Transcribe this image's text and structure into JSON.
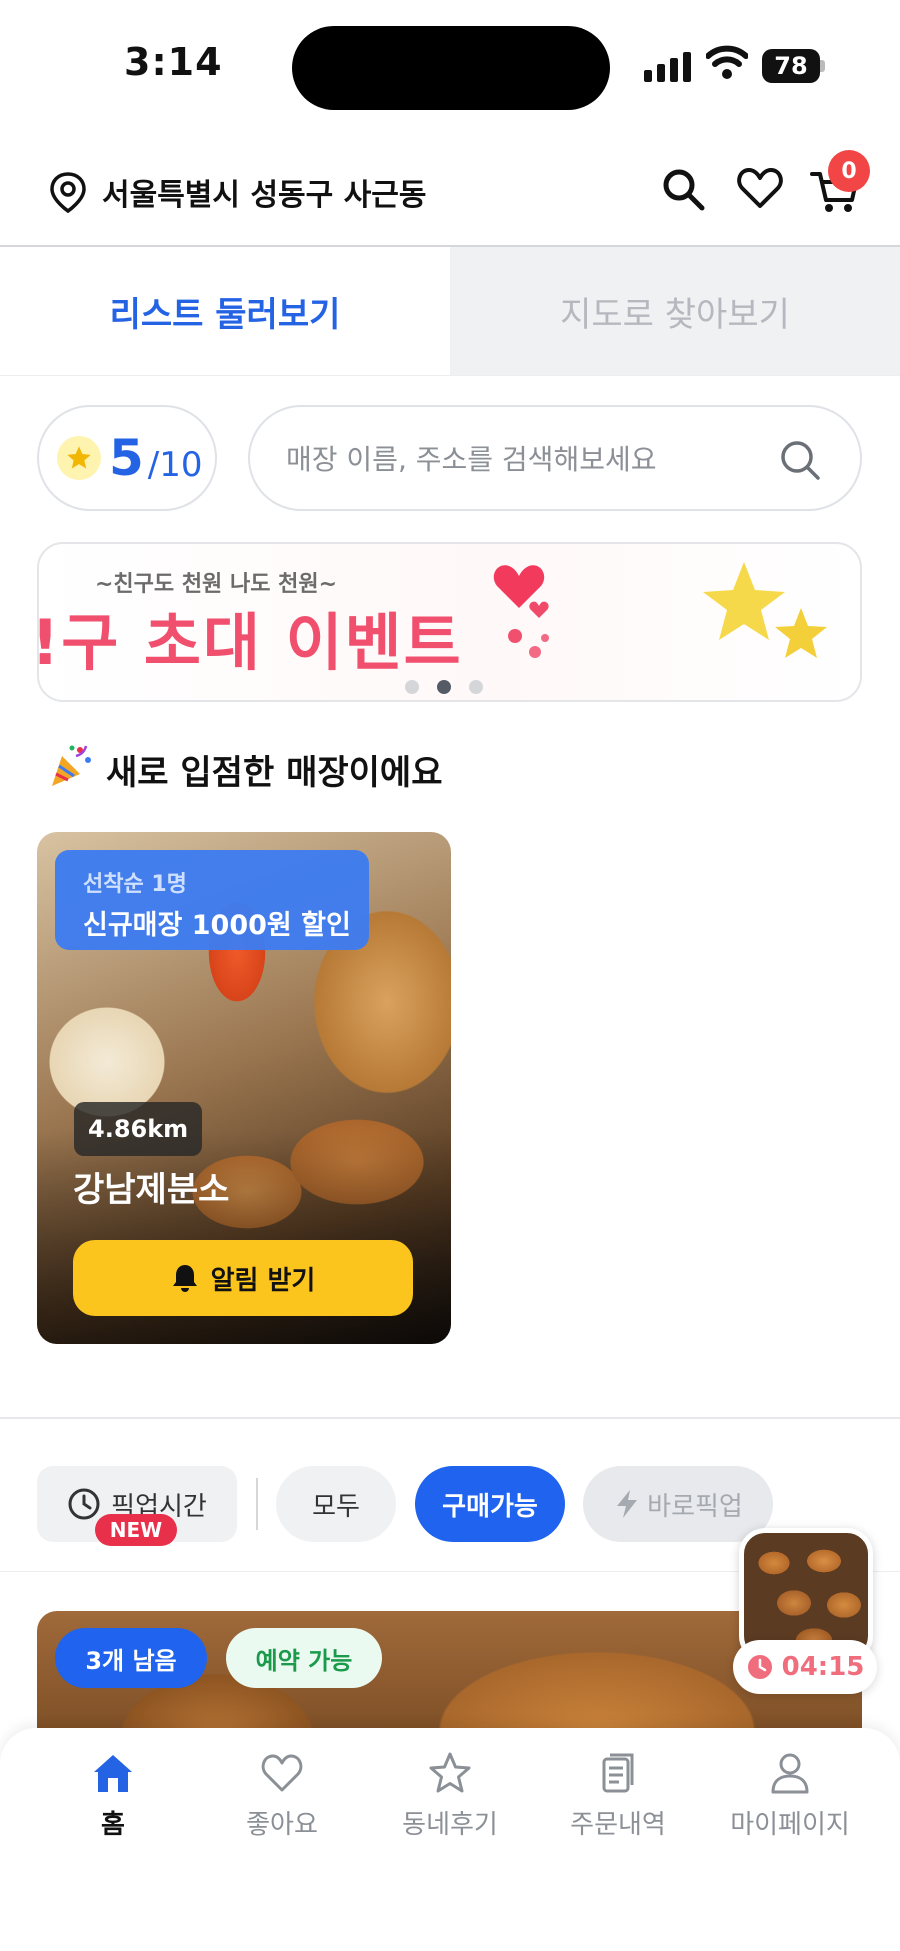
{
  "status_bar": {
    "time": "3:14",
    "battery": "78"
  },
  "header": {
    "location": "서울특별시 성동구 사근동",
    "cart_count": "0"
  },
  "view_tabs": {
    "list": "리스트 둘러보기",
    "map": "지도로 찾아보기"
  },
  "rating": {
    "value": "5",
    "max": "/10"
  },
  "search": {
    "placeholder": "매장 이름, 주소를 검색해보세요"
  },
  "banner": {
    "subtitle": "~친구도 천원 나도 천원~",
    "title": "!구 초대 이벤트",
    "active_index": 1,
    "count": 3
  },
  "new_stores": {
    "title": "새로 입점한 매장이에요",
    "store": {
      "promo_sub": "선착순 1명",
      "promo_main": "신규매장 1000원 할인",
      "distance": "4.86km",
      "name": "강남제분소",
      "alert_label": "알림 받기"
    }
  },
  "filters": {
    "pickup_time": "픽업시간",
    "new_badge": "NEW",
    "all": "모두",
    "buyable": "구매가능",
    "quick_pickup": "바로픽업"
  },
  "floating_timer": {
    "time": "04:15"
  },
  "listing": {
    "remaining": "3개 남음",
    "reservation": "예약 가능"
  },
  "bottom_nav": [
    {
      "label": "홈",
      "icon": "home-icon",
      "active": true
    },
    {
      "label": "좋아요",
      "icon": "heart-icon",
      "active": false
    },
    {
      "label": "동네후기",
      "icon": "star-icon",
      "active": false
    },
    {
      "label": "주문내역",
      "icon": "receipt-icon",
      "active": false
    },
    {
      "label": "마이페이지",
      "icon": "person-icon",
      "active": false
    }
  ],
  "colors": {
    "accent": "#2563e5",
    "button_yellow": "#fcc51d",
    "badge_red": "#f24545"
  }
}
